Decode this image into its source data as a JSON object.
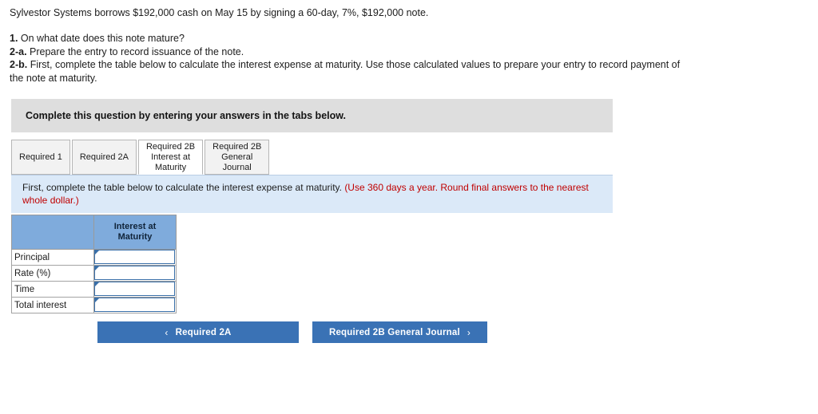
{
  "question": {
    "stem": "Sylvestor Systems borrows $192,000 cash on May 15 by signing a 60-day, 7%, $192,000 note.",
    "requirements": [
      {
        "num": "1.",
        "text": " On what date does this note mature?"
      },
      {
        "num": "2-a.",
        "text": " Prepare the entry to record issuance of the note."
      },
      {
        "num": "2-b.",
        "text": " First, complete the table below to calculate the interest expense at maturity. Use those calculated values to prepare your entry to record payment of the note at maturity."
      }
    ]
  },
  "instruction_band": {
    "text": "Complete this question by entering your answers in the tabs below."
  },
  "tabs": [
    {
      "label": "Required 1",
      "active": false
    },
    {
      "label": "Required 2A",
      "active": false
    },
    {
      "label": "Required 2B\nInterest at\nMaturity",
      "active": true
    },
    {
      "label": "Required 2B\nGeneral\nJournal",
      "active": false
    }
  ],
  "infobar": {
    "text": "First, complete the table below to calculate the interest expense at maturity. ",
    "hint": "(Use 360 days a year. Round final answers to the nearest whole dollar.)"
  },
  "table": {
    "corner_header": "",
    "column_header": "Interest at Maturity",
    "rows": [
      {
        "label": "Principal",
        "value": "",
        "placeholder": ""
      },
      {
        "label": "Rate (%)",
        "value": "",
        "placeholder": ""
      },
      {
        "label": "Time",
        "value": "",
        "placeholder": ""
      },
      {
        "label": "Total interest",
        "value": "",
        "placeholder": ""
      }
    ]
  },
  "nav": {
    "prev_label": "Required 2A",
    "prev_chevron": "‹",
    "next_label": "Required 2B General Journal",
    "next_chevron": "›"
  },
  "colors": {
    "table_header_blue": "#7fabdc",
    "infobar_blue": "#dbe9f8",
    "band_gray": "#dedede",
    "button_blue": "#3a72b5",
    "hint_red": "#c00000",
    "input_border_blue": "#3a6fa8"
  }
}
